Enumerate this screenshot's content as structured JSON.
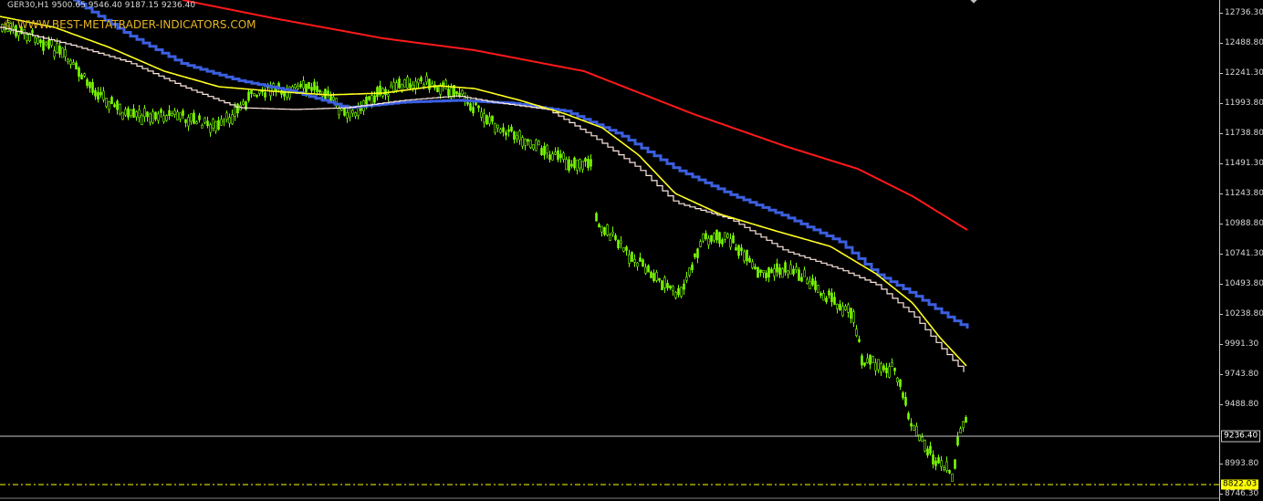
{
  "chart": {
    "info": {
      "symbol": "GER30,H1",
      "ohlc": "9500.65 9546.40 9187.15 9236.40"
    },
    "watermark": "© WWW.BEST-METATRADER-INDICATORS.COM",
    "price_axis": {
      "labels": [
        "12736.30",
        "12488.80",
        "12241.30",
        "11993.80",
        "11738.80",
        "11491.30",
        "11243.80",
        "10988.80",
        "10741.30",
        "10493.80",
        "10238.80",
        "9991.30",
        "9743.80",
        "9488.80",
        "8993.80",
        "8746.30"
      ],
      "current_price": "9236.40",
      "level_price": "8822.03"
    },
    "colors": {
      "background": "#000000",
      "candles": "#7CFC00",
      "ma_red": "#ff1a1a",
      "ma_blue": "#3b5fe0",
      "ma_yellow": "#ffff20",
      "ma_white": "#ffe8e0",
      "level_line": "#ffff00",
      "price_line": "#c8c8c8"
    },
    "indicators": [
      "red-moving-average",
      "blue-stepped-moving-average",
      "yellow-moving-average",
      "white-stepped-moving-average"
    ]
  }
}
